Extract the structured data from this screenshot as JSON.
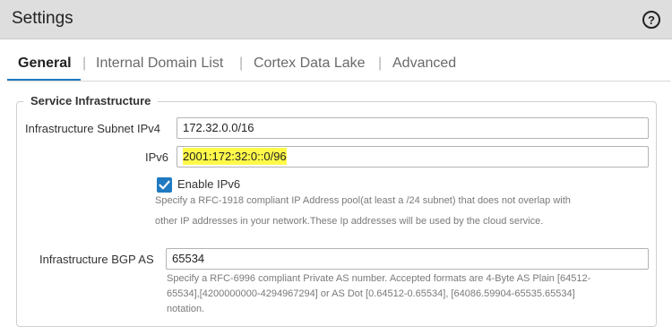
{
  "window": {
    "title": "Settings",
    "help_icon": "question-circle-icon"
  },
  "tabs": [
    {
      "label": "General",
      "active": true
    },
    {
      "label": "Internal Domain List",
      "active": false
    },
    {
      "label": "Cortex Data Lake",
      "active": false
    },
    {
      "label": "Advanced",
      "active": false
    }
  ],
  "service_infrastructure": {
    "legend": "Service Infrastructure",
    "subnet_ipv4": {
      "label": "Infrastructure Subnet IPv4",
      "value": "172.32.0.0/16"
    },
    "ipv6": {
      "label": "IPv6",
      "value": "2001:172:32:0::0/96"
    },
    "enable_ipv6": {
      "label": "Enable IPv6",
      "checked": true,
      "help_line1": "Specify a RFC-1918 compliant IP Address pool(at least a /24 subnet) that does not overlap with",
      "help_line2": "other IP addresses in your network.These Ip addresses will be used by the cloud service."
    },
    "bgp_as": {
      "label": "Infrastructure BGP AS",
      "value": "65534",
      "help_line1": "Specify a RFC-6996 compliant Private AS number. Accepted formats are 4-Byte AS Plain [64512-",
      "help_line2": "65534],[4200000000-4294967294] or AS Dot [0.64512-0.65534], [64086.59904-65535.65534]",
      "help_line3": "notation."
    }
  },
  "colors": {
    "accent": "#1f7ac1",
    "highlight": "#fff94a",
    "titlebar": "#dedede"
  }
}
